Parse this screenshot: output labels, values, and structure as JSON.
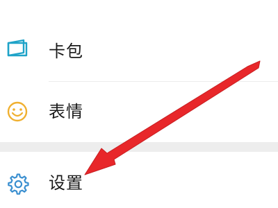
{
  "menu": {
    "items": [
      {
        "label": "卡包",
        "icon": "card-wallet-icon"
      },
      {
        "label": "表情",
        "icon": "smiley-icon"
      },
      {
        "label": "设置",
        "icon": "gear-icon"
      }
    ]
  },
  "colors": {
    "card_icon": "#1fa3c8",
    "smiley_icon": "#f0b030",
    "gear_icon": "#3a8fd0",
    "arrow": "#e8272a",
    "divider": "#ededed"
  }
}
